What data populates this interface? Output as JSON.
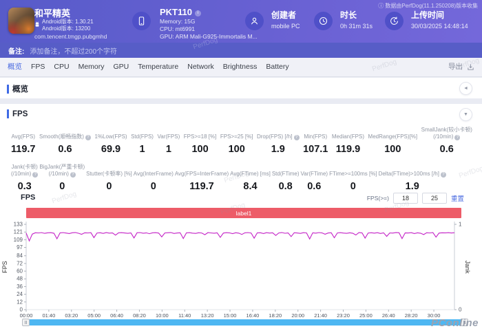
{
  "header": {
    "version_note": "ⓘ 数据由PerfDog(11.1.250208)版本收集",
    "app": {
      "name": "和平精英",
      "version_line1": "Android版本: 1.30.21",
      "version_line2": "Android版本: 13200",
      "package": "com.tencent.tmgp.pubgmhd"
    },
    "device": {
      "model": "PKT110",
      "memory": "Memory: 15G",
      "cpu": "CPU: mt6991",
      "gpu": "GPU: ARM Mali-G925-Immortalis M..."
    },
    "creator": {
      "label": "创建者",
      "value": "mobile PC"
    },
    "duration": {
      "label": "时长",
      "value": "0h 31m 31s"
    },
    "upload": {
      "label": "上传时间",
      "value": "30/03/2025 14:48:14"
    }
  },
  "note_bar": {
    "label": "备注:",
    "placeholder": "添加备注，不超过200个字符"
  },
  "tab_bar": {
    "items": [
      "概览",
      "FPS",
      "CPU",
      "Memory",
      "GPU",
      "Temperature",
      "Network",
      "Brightness",
      "Battery"
    ],
    "active": "概览",
    "export_label": "导出"
  },
  "overview_section": {
    "title": "概览"
  },
  "fps_section": {
    "title": "FPS",
    "chart_title": "FPS"
  },
  "fps_filter": {
    "label": "FPS(>=)",
    "threshold1": "18",
    "threshold2": "25",
    "reset_label": "重置"
  },
  "stats_row1": [
    {
      "label": "Avg(FPS)",
      "value": "119.7"
    },
    {
      "label": "Smooth(顺畅指数)",
      "info": true,
      "value": "0.6"
    },
    {
      "label": "1%Low(FPS)",
      "value": "69.9"
    },
    {
      "label": "Std(FPS)",
      "value": "1"
    },
    {
      "label": "Var(FPS)",
      "value": "1"
    },
    {
      "label": "FPS>=18 [%]",
      "value": "100"
    },
    {
      "label": "FPS>=25 [%]",
      "value": "100"
    },
    {
      "label": "Drop(FPS) [/h]",
      "info": true,
      "value": "1.9"
    },
    {
      "label": "Min(FPS)",
      "value": "107.1"
    },
    {
      "label": "Median(FPS)",
      "value": "119.9"
    },
    {
      "label": "MedRange(FPS)[%]",
      "value": "100"
    },
    {
      "label": "SmallJank(较小卡顿)",
      "label2": "(/10min)",
      "info": true,
      "value": "0.6"
    }
  ],
  "stats_row2": [
    {
      "label": "Jank(卡顿)",
      "label2": "(/10min)",
      "info": true,
      "value": "0.3"
    },
    {
      "label": "BigJank(严重卡顿)",
      "label2": "(/10min)",
      "info": true,
      "value": "0"
    },
    {
      "label": "Stutter(卡顿率) [%]",
      "value": "0"
    },
    {
      "label": "Avg(InterFrame)",
      "value": "0"
    },
    {
      "label": "Avg(FPS=InterFrame)",
      "value": "119.7"
    },
    {
      "label": "Avg(FTime) [ms]",
      "value": "8.4"
    },
    {
      "label": "Std(FTime)",
      "value": "0.8"
    },
    {
      "label": "Var(FTime)",
      "value": "0.6"
    },
    {
      "label": "FTime>=100ms [%]",
      "value": "0"
    },
    {
      "label": "Delta(FTime)>100ms [/h]",
      "info": true,
      "value": "1.9"
    }
  ],
  "chart_data": {
    "type": "line",
    "title": "FPS",
    "series_name": "FPS",
    "banner_label": "label1",
    "banner_color": "#ed5c68",
    "line_color": "#c320c6",
    "left_axis_label": "FPS",
    "right_axis_label": "Jank",
    "y_ticks_left": [
      133,
      121,
      109,
      97,
      84,
      72,
      60,
      48,
      36,
      24,
      12,
      0
    ],
    "ylim_left": [
      0,
      133
    ],
    "y_ticks_right": [
      1,
      0
    ],
    "ylim_right": [
      0,
      1
    ],
    "x_ticks": [
      "00:00",
      "01:40",
      "03:20",
      "05:00",
      "06:40",
      "08:20",
      "10:00",
      "11:40",
      "13:20",
      "15:00",
      "16:40",
      "18:20",
      "20:00",
      "21:40",
      "23:20",
      "25:00",
      "26:40",
      "28:20",
      "30:00"
    ],
    "duration_sec": 1891,
    "values": [
      119.5,
      107.1,
      117.8,
      119.9,
      119.6,
      120.1,
      118.9,
      119.8,
      120.0,
      119.2,
      110.5,
      119.7,
      120.1,
      119.4,
      118.6,
      119.9,
      120.2,
      119.1,
      117.5,
      119.8,
      119.6,
      120.0,
      112.3,
      119.5,
      119.9,
      118.8,
      120.1,
      119.3,
      119.7,
      116.2,
      119.8,
      120.0,
      119.5,
      118.9,
      119.6,
      111.8,
      119.9,
      120.1,
      119.2,
      119.7,
      118.4,
      119.8,
      120.0,
      119.4,
      113.5,
      119.6,
      119.9,
      120.2,
      118.7,
      119.5,
      119.8,
      110.9,
      119.7,
      120.0,
      119.3,
      118.8,
      119.9,
      119.5,
      116.8,
      120.1,
      119.6,
      119.2,
      119.8,
      112.7,
      119.4,
      120.0,
      119.7,
      118.5,
      119.9,
      119.3,
      117.2,
      119.8,
      120.1,
      119.5,
      111.4,
      119.7,
      119.9,
      118.6,
      120.0,
      119.4,
      119.8,
      115.6,
      119.6,
      120.2,
      119.1,
      119.7,
      113.9,
      119.9,
      119.5,
      118.8,
      120.0,
      119.6,
      110.2,
      119.8,
      119.3,
      120.1,
      119.7,
      117.6,
      119.5,
      119.9,
      112.1,
      119.6,
      120.0,
      119.4,
      118.9,
      119.8,
      119.2,
      116.4,
      120.1,
      119.7,
      111.6,
      119.5,
      119.9,
      119.3,
      120.0,
      118.7,
      119.8,
      114.2,
      119.6,
      119.4,
      120.2,
      119.9,
      110.8,
      119.7,
      119.5,
      120.0,
      118.6,
      119.8,
      119.2,
      117.0,
      119.9,
      119.6,
      120.1,
      113.1,
      119.4,
      119.8,
      119.7,
      120.0,
      119.5,
      119.9
    ]
  },
  "watermarks": {
    "perfdog": "PerfDog",
    "pconline": "PConline"
  }
}
